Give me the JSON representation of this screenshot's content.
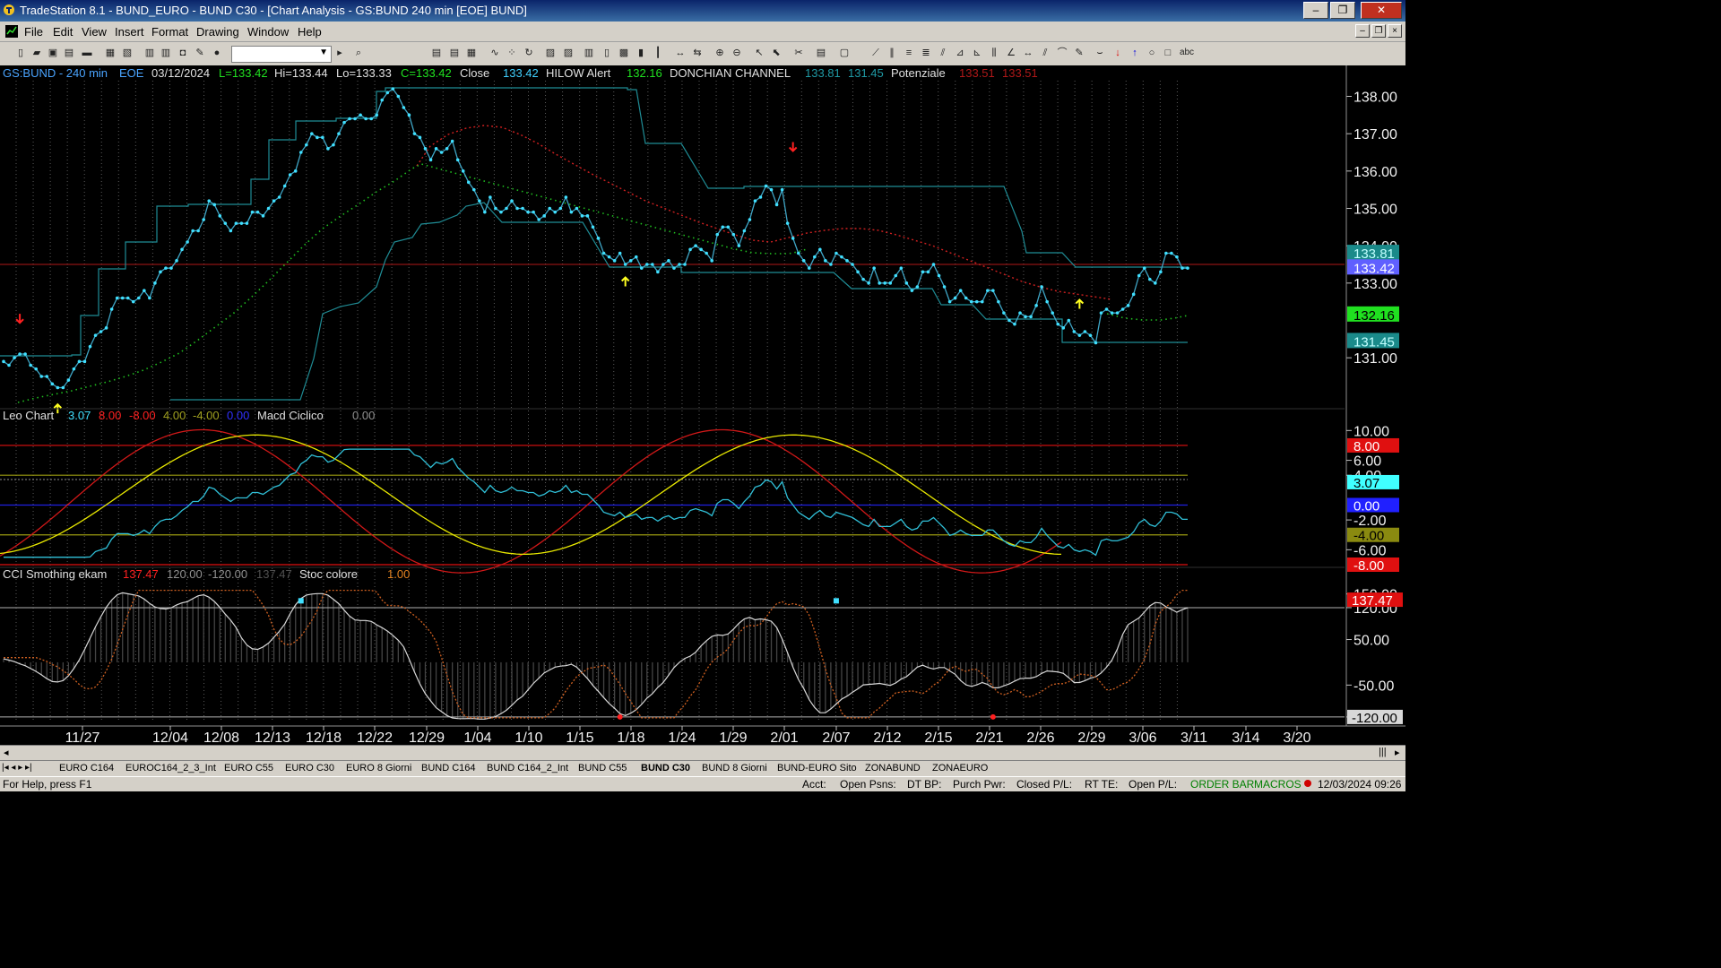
{
  "window": {
    "title": "TradeStation 8.1 - BUND_EURO - BUND  C30 - [Chart Analysis - GS:BUND  240 min  [EOE] BUND]",
    "buttons": {
      "minimize": "–",
      "maximize": "❐",
      "close": "✕"
    }
  },
  "menu": [
    "File",
    "Edit",
    "View",
    "Insert",
    "Format",
    "Drawing",
    "Window",
    "Help"
  ],
  "colors": {
    "background": "#000000",
    "price_line": "#3fa6c6",
    "price_dot": "#40e0ff",
    "donchian": "#1f8c95",
    "red": "#e01010",
    "yellow": "#e8e800",
    "green_dots": "#20c020",
    "grid": "#6e6e6e",
    "cyan_label": "#40c0ff",
    "green_label": "#20e020"
  },
  "price_pane": {
    "header": {
      "symbol": "GS:BUND - 240 min",
      "session": "EOE",
      "date": "03/12/2024",
      "low_eq": "L=133.42",
      "high": "Hi=133.44",
      "lo": "Lo=133.33",
      "close_eq": "C=133.42",
      "close_label": "Close",
      "close_value": "133.42",
      "hilow_label": "HILOW Alert",
      "hilow_value": "132.16",
      "donchian_label": "DONCHIAN CHANNEL",
      "donchian_hi": "133.81",
      "donchian_lo": "131.45",
      "pot_label": "Potenziale",
      "pot_v1": "133.51",
      "pot_v2": "133.51"
    },
    "y_ticks": [
      "138.00",
      "137.00",
      "136.00",
      "135.00",
      "134.00",
      "133.00",
      "131.00"
    ],
    "y_range": [
      129.9,
      138.3
    ],
    "horizontal_line": 133.5,
    "tags": [
      {
        "text": "133.81",
        "value": 133.81,
        "bg": "#1a8a8a",
        "fg": "#c0ffff"
      },
      {
        "text": "133.42",
        "value": 133.42,
        "bg": "#6060ff",
        "fg": "#ffffff"
      },
      {
        "text": "132.16",
        "value": 132.16,
        "bg": "#20e020",
        "fg": "#000000"
      },
      {
        "text": "131.45",
        "value": 131.45,
        "bg": "#1a8a8a",
        "fg": "#c0ffff"
      }
    ],
    "down_arrows": [
      {
        "bar": 3,
        "value": 131.6
      },
      {
        "bar": 146,
        "value": 136.2
      }
    ],
    "up_arrows": [
      {
        "bar": 10,
        "value": 129.8
      },
      {
        "bar": 115,
        "value": 133.2
      },
      {
        "bar": 199,
        "value": 132.6
      }
    ]
  },
  "osc_pane": {
    "header": {
      "name": "Leo Chart",
      "v1": "3.07",
      "v2": "8.00",
      "v3": "-8.00",
      "v4": "4.00",
      "v5": "-4.00",
      "v6": "0.00",
      "macd_label": "Macd Ciclico",
      "macd_value": "0.00"
    },
    "y_ticks": [
      "10.00",
      "6.00",
      "4.00",
      "-2.00",
      "-6.00"
    ],
    "y_range": [
      -8.0,
      11.0
    ],
    "levels": [
      {
        "value": 8,
        "color": "#e01010"
      },
      {
        "value": -8,
        "color": "#e01010"
      },
      {
        "value": 4,
        "color": "#9a9a10"
      },
      {
        "value": -4,
        "color": "#9a9a10"
      },
      {
        "value": 0,
        "color": "#2020e0"
      }
    ],
    "tags": [
      {
        "text": "8.00",
        "value": 8,
        "bg": "#e01010",
        "fg": "#ffffff"
      },
      {
        "text": "3.07",
        "value": 3.07,
        "bg": "#40ffff",
        "fg": "#000000"
      },
      {
        "text": "0.00",
        "value": 0,
        "bg": "#2020ff",
        "fg": "#ffffff"
      },
      {
        "text": "-4.00",
        "value": -4,
        "bg": "#8a8a10",
        "fg": "#000000"
      },
      {
        "text": "-8.00",
        "value": -8,
        "bg": "#e01010",
        "fg": "#ffffff"
      }
    ]
  },
  "cci_pane": {
    "header": {
      "name": "CCI Smothing ekam",
      "v1": "137.47",
      "v2": "120.00",
      "v3": "-120.00",
      "v4": "137.47",
      "stoc_label": "Stoc colore",
      "stoc_value": "1.00"
    },
    "y_ticks": [
      "150.00",
      "120.00",
      "50.00",
      "-50.00",
      "-120.00"
    ],
    "y_range": [
      -130,
      175
    ],
    "levels": [
      120,
      -120
    ],
    "tags": [
      {
        "text": "137.47",
        "value": 137.47,
        "bg": "#e01010",
        "fg": "#ffffff"
      },
      {
        "text": "-120.00",
        "value": -120,
        "bg": "#d8d8d8",
        "fg": "#000000"
      }
    ],
    "cyan_markers": [
      {
        "bar": 55,
        "value": 135
      },
      {
        "bar": 154,
        "value": 135
      }
    ],
    "red_markers": [
      {
        "bar": 114,
        "value": -120
      },
      {
        "bar": 183,
        "value": -120
      }
    ]
  },
  "x_axis": {
    "labels": [
      "11/27",
      "12/04",
      "12/08",
      "12/13",
      "12/18",
      "12/22",
      "12/29",
      "1/04",
      "1/10",
      "1/15",
      "1/18",
      "1/24",
      "1/29",
      "2/01",
      "2/07",
      "2/12",
      "2/15",
      "2/21",
      "2/26",
      "2/29",
      "3/06",
      "3/11",
      "3/14",
      "3/20"
    ]
  },
  "chart_data": {
    "type": "line",
    "title": "GS:BUND - 240 min",
    "series": [
      {
        "name": "Close",
        "values": [
          130.9,
          130.8,
          131.0,
          131.1,
          131.1,
          130.8,
          130.7,
          130.5,
          130.5,
          130.3,
          130.2,
          130.2,
          130.4,
          130.7,
          130.9,
          130.9,
          131.3,
          131.6,
          131.7,
          131.8,
          132.3,
          132.6,
          132.6,
          132.6,
          132.5,
          132.6,
          132.8,
          132.6,
          133.0,
          133.3,
          133.4,
          133.4,
          133.6,
          133.9,
          134.1,
          134.4,
          134.4,
          134.7,
          135.2,
          135.1,
          134.8,
          134.6,
          134.4,
          134.6,
          134.6,
          134.6,
          134.9,
          134.9,
          134.8,
          135.0,
          135.2,
          135.3,
          135.6,
          135.9,
          136.0,
          136.5,
          136.7,
          137.0,
          136.9,
          136.9,
          136.6,
          136.7,
          137.0,
          137.3,
          137.4,
          137.4,
          137.5,
          137.4,
          137.4,
          137.5,
          137.9,
          138.1,
          138.2,
          138.0,
          137.7,
          137.5,
          137.0,
          136.9,
          136.6,
          136.3,
          136.6,
          136.5,
          136.6,
          136.8,
          136.3,
          136.0,
          135.7,
          135.5,
          135.2,
          134.9,
          135.3,
          135.0,
          134.9,
          135.0,
          135.2,
          135.0,
          135.0,
          134.9,
          134.9,
          134.7,
          134.8,
          135.0,
          134.9,
          135.0,
          135.3,
          134.9,
          135.0,
          134.8,
          134.8,
          134.5,
          134.2,
          133.8,
          133.7,
          133.6,
          133.8,
          133.5,
          133.6,
          133.7,
          133.4,
          133.5,
          133.5,
          133.3,
          133.5,
          133.6,
          133.4,
          133.5,
          133.5,
          133.9,
          134.0,
          133.9,
          133.8,
          133.6,
          134.3,
          134.5,
          134.5,
          134.3,
          134.0,
          134.4,
          134.7,
          135.2,
          135.3,
          135.6,
          135.5,
          135.1,
          135.5,
          134.6,
          134.2,
          133.8,
          133.6,
          133.4,
          133.7,
          133.9,
          133.6,
          133.5,
          133.8,
          133.7,
          133.6,
          133.5,
          133.3,
          133.1,
          133.0,
          133.4,
          133.0,
          133.0,
          133.0,
          133.2,
          133.4,
          133.0,
          132.8,
          132.9,
          133.3,
          133.3,
          133.5,
          133.2,
          132.9,
          132.5,
          132.6,
          132.8,
          132.6,
          132.5,
          132.5,
          132.5,
          132.8,
          132.8,
          132.5,
          132.2,
          132.0,
          131.9,
          132.2,
          132.1,
          132.1,
          132.4,
          132.9,
          132.5,
          132.2,
          131.9,
          131.8,
          132.0,
          131.7,
          131.6,
          131.7,
          131.6,
          131.4,
          132.2,
          132.3,
          132.2,
          132.2,
          132.3,
          132.4,
          132.7,
          133.2,
          133.4,
          133.1,
          133.0,
          133.3,
          133.8,
          133.8,
          133.7,
          133.4,
          133.4
        ]
      }
    ],
    "xlabel": "",
    "ylabel": "",
    "ylim": [
      129.9,
      138.3
    ]
  }
}
